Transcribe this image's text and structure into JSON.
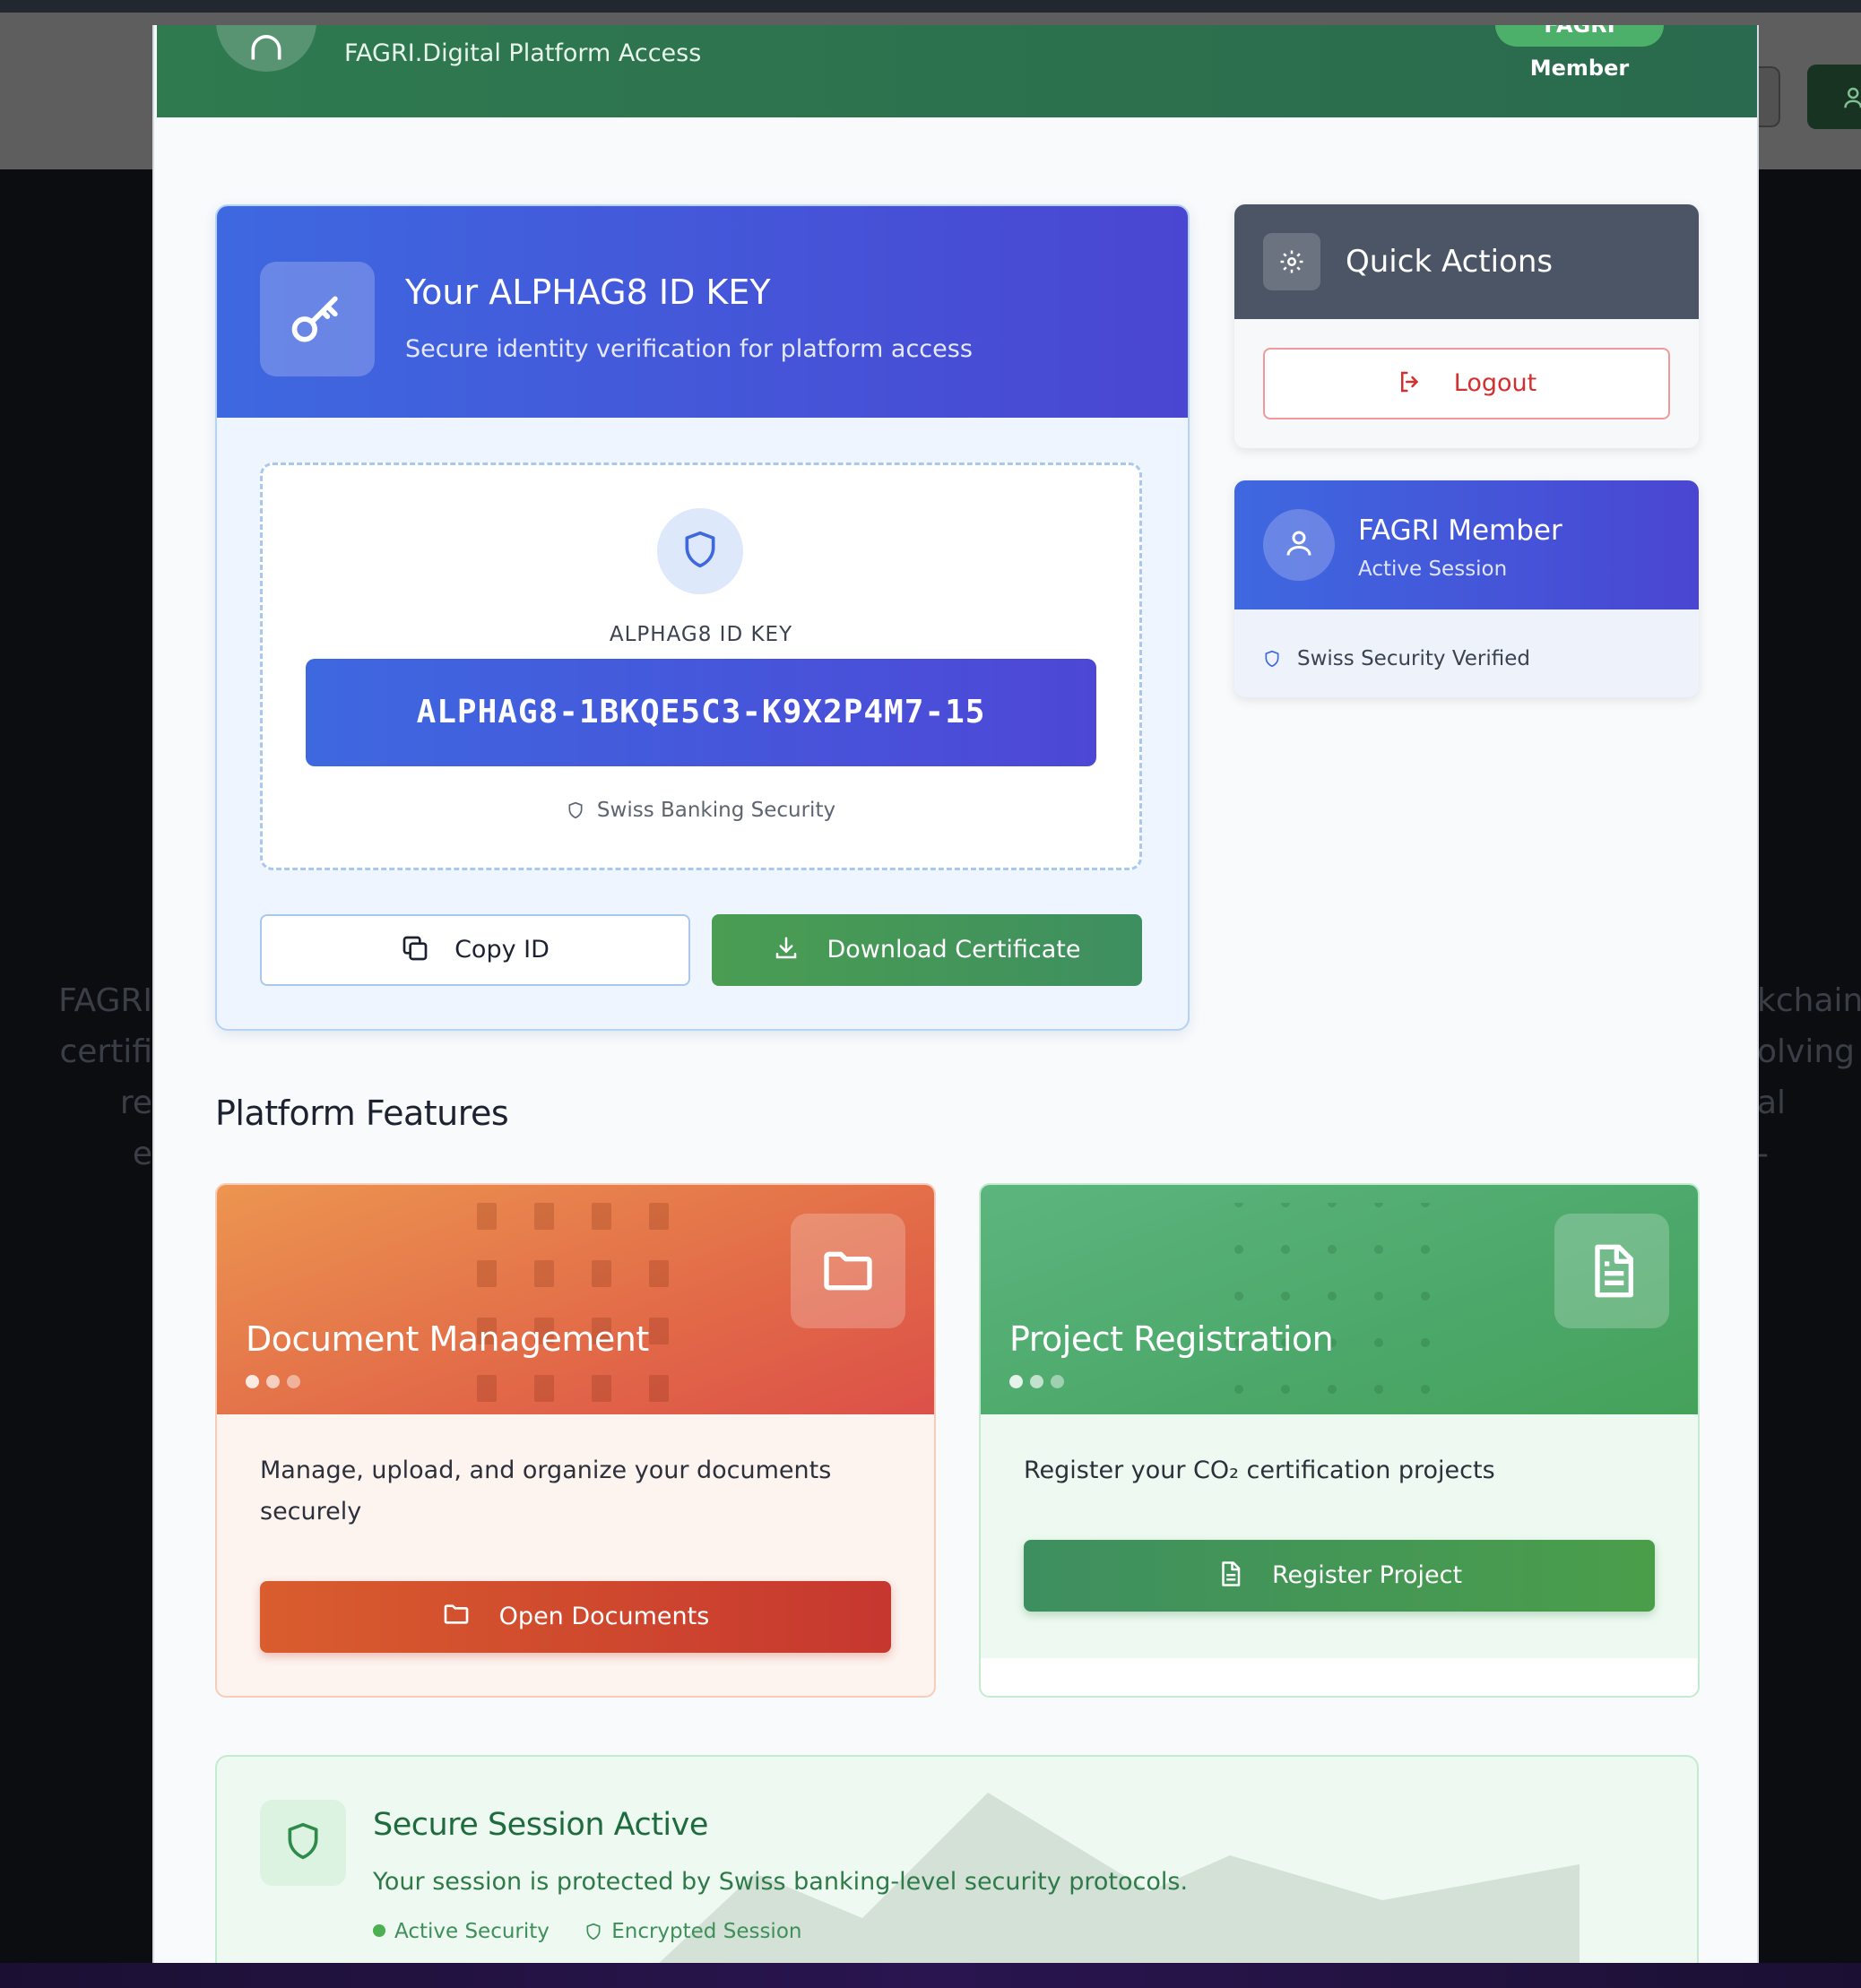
{
  "background": {
    "left_text": [
      "FAGRI",
      "certifi",
      "re",
      "e"
    ],
    "right_text": [
      "kchain",
      "olving",
      "al",
      "-"
    ]
  },
  "modal": {
    "subtitle": "FAGRI.Digital Platform Access",
    "badge": "FAGRI Member"
  },
  "id_card": {
    "title": "Your ALPHAG8 ID KEY",
    "subtitle": "Secure identity verification for platform access",
    "key_label": "ALPHAG8 ID KEY",
    "key_value": "ALPHAG8-1BKQE5C3-K9X2P4M7-15",
    "security_note": "Swiss Banking Security",
    "copy_button": "Copy ID",
    "download_button": "Download Certificate"
  },
  "quick_actions": {
    "title": "Quick Actions",
    "logout_button": "Logout"
  },
  "member": {
    "name": "FAGRI Member",
    "status": "Active Session",
    "verified": "Swiss Security Verified"
  },
  "features": {
    "title": "Platform Features",
    "documents": {
      "title": "Document Management",
      "description": "Manage, upload, and organize your documents securely",
      "button": "Open Documents"
    },
    "project": {
      "title": "Project Registration",
      "description": "Register your CO₂ certification projects",
      "button": "Register Project"
    }
  },
  "session": {
    "title": "Secure Session Active",
    "description": "Your session is protected by Swiss banking-level security protocols.",
    "tag_active": "Active Security",
    "tag_encrypted": "Encrypted Session"
  },
  "colors": {
    "header_green": "#2f7a4f",
    "primary_blue": "#3e68e0",
    "accent_orange": "#d95d2e",
    "accent_green": "#3e8f60",
    "logout_red": "#d32f2f"
  },
  "icons": [
    "user-icon",
    "key-icon",
    "shield-icon",
    "copy-icon",
    "download-icon",
    "gear-icon",
    "logout-icon",
    "folder-icon",
    "file-text-icon"
  ]
}
